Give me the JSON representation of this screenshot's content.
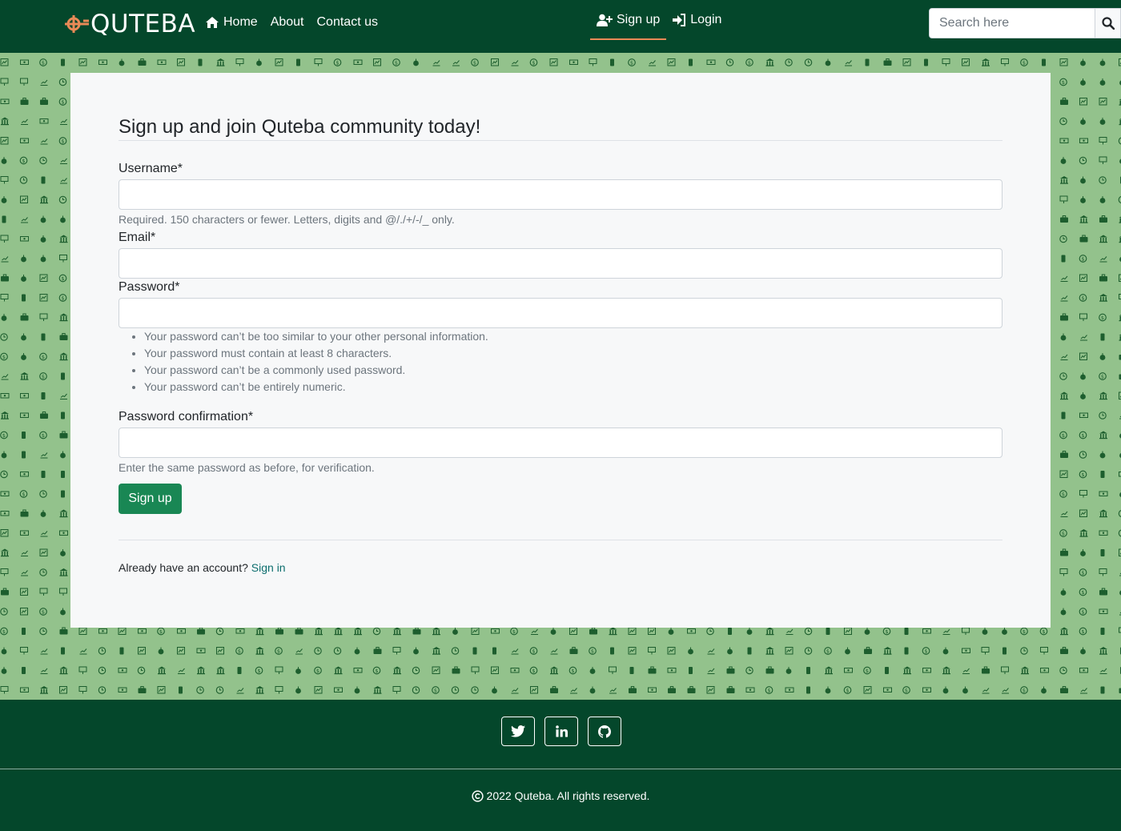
{
  "navbar": {
    "brand": "QUTEBA",
    "links": [
      {
        "label": "Home",
        "icon": "home-icon"
      },
      {
        "label": "About"
      },
      {
        "label": "Contact us"
      }
    ],
    "auth": [
      {
        "label": "Sign up",
        "icon": "user-plus-icon",
        "active": true
      },
      {
        "label": "Login",
        "icon": "sign-in-icon",
        "active": false
      }
    ],
    "search": {
      "placeholder": "Search here",
      "value": ""
    }
  },
  "form": {
    "title": "Sign up and join Quteba community today!",
    "username": {
      "label": "Username*",
      "value": "",
      "help": "Required. 150 characters or fewer. Letters, digits and @/./+/-/_ only."
    },
    "email": {
      "label": "Email*",
      "value": ""
    },
    "password": {
      "label": "Password*",
      "value": "",
      "help": [
        "Your password can’t be too similar to your other personal information.",
        "Your password must contain at least 8 characters.",
        "Your password can’t be a commonly used password.",
        "Your password can’t be entirely numeric."
      ]
    },
    "password_confirmation": {
      "label": "Password confirmation*",
      "value": "",
      "help": "Enter the same password as before, for verification."
    },
    "submit_label": "Sign up",
    "already_text": "Already have an account?",
    "signin_link": "Sign in"
  },
  "footer": {
    "social": [
      {
        "name": "twitter-icon"
      },
      {
        "name": "linkedin-icon"
      },
      {
        "name": "github-icon"
      }
    ],
    "copyright": "2022 Quteba. All rights reserved."
  },
  "colors": {
    "nav_bg": "#04472b",
    "pattern_bg": "#93c28c",
    "pattern_icon": "#1d5e2e",
    "accent": "#e98a57",
    "button": "#198754",
    "link": "#0d6e6e"
  }
}
